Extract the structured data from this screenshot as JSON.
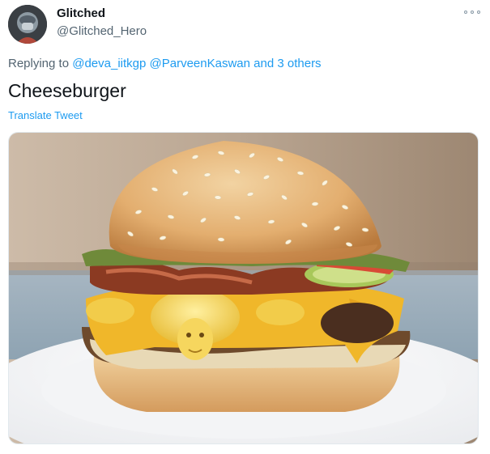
{
  "author": {
    "display_name": "Glitched",
    "handle": "@Glitched_Hero",
    "avatar_icon": "avatar-icon"
  },
  "menu": {
    "icon": "more-options-icon"
  },
  "reply": {
    "prefix": "Replying to",
    "mention_1": "@deva_iitkgp",
    "mention_2": "@ParveenKaswan",
    "connector": "and",
    "others": "3 others"
  },
  "tweet": {
    "text": "Cheeseburger",
    "translate_label": "Translate Tweet"
  },
  "colors": {
    "link": "#1d9bf0",
    "secondary_text": "#536471",
    "primary_text": "#0f1419"
  }
}
